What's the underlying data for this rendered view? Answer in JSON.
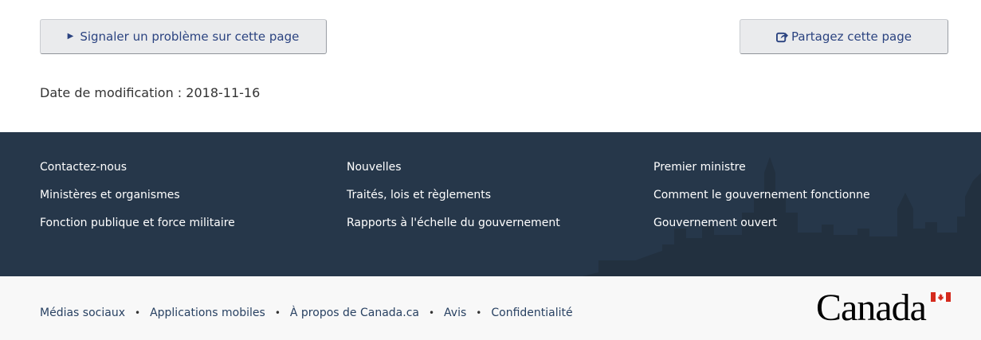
{
  "actions": {
    "report_label": "Signaler un problème sur cette page",
    "share_label": "Partagez cette page"
  },
  "modified": "Date de modification : 2018-11-16",
  "footer": {
    "col1": [
      "Contactez-nous",
      "Ministères et organismes",
      "Fonction publique et force militaire"
    ],
    "col2": [
      "Nouvelles",
      "Traités, lois et règlements",
      "Rapports à l'échelle du gouvernement"
    ],
    "col3": [
      "Premier ministre",
      "Comment le gouvernement fonctionne",
      "Gouvernement ouvert"
    ]
  },
  "subfooter": {
    "links": [
      "Médias sociaux",
      "Applications mobiles",
      "À propos de Canada.ca",
      "Avis",
      "Confidentialité"
    ],
    "wordmark": "Canada"
  },
  "colors": {
    "footer_bg": "#26374a",
    "link": "#284162",
    "button_text": "#2b4380",
    "flag_red": "#d52b1e"
  }
}
